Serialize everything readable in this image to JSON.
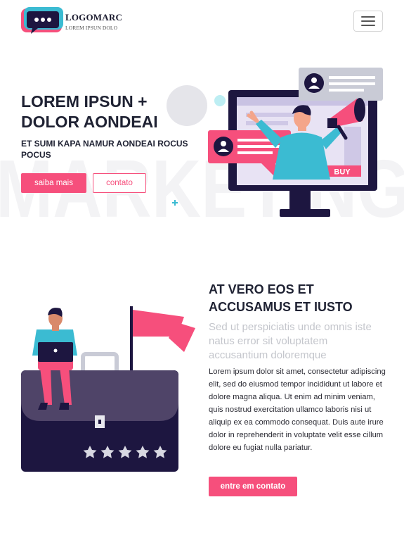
{
  "header": {
    "brand_name": "LOGOMARC",
    "brand_tagline": "LOREM IPSUN DOLO"
  },
  "hero": {
    "title": "LOREM IPSUN + DOLOR AONDEAI",
    "subtitle": "ET SUMI KAPA NAMUR AONDEAI ROCUS POCUS",
    "primary_button": "saiba mais",
    "secondary_button": "contato",
    "background_word": "MARKETING",
    "illustration_button": "BUY"
  },
  "section": {
    "title": "AT VERO EOS ET ACCUSAMUS ET IUSTO",
    "lead": "Sed ut perspiciatis unde omnis iste natus error sit voluptatem accusantium doloremque",
    "body": "Lorem ipsum dolor sit amet, consectetur adipiscing elit, sed do eiusmod tempor incididunt ut labore et dolore magna aliqua. Ut enim ad minim veniam, quis nostrud exercitation ullamco laboris nisi ut aliquip ex ea commodo consequat. Duis aute irure dolor in reprehenderit in voluptate velit esse cillum dolore eu fugiat nulla pariatur.",
    "cta_button": "entre em contato",
    "rating_stars": 5
  },
  "colors": {
    "accent": "#f64f7c",
    "dark": "#1f2233",
    "navy": "#1d1640",
    "teal": "#3bbbd2",
    "muted_text": "#c4c6cc"
  },
  "icons": {
    "menu": "hamburger-icon",
    "logo": "chat-bubble-icon"
  }
}
